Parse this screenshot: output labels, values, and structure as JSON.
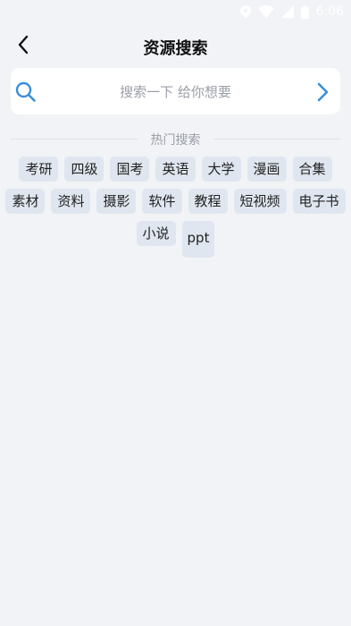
{
  "status_bar": {
    "time": "6:06"
  },
  "header": {
    "title": "资源搜索"
  },
  "search": {
    "placeholder": "搜索一下 给你想要",
    "value": ""
  },
  "hot": {
    "title": "热门搜索",
    "tags": [
      "考研",
      "四级",
      "国考",
      "英语",
      "大学",
      "漫画",
      "合集",
      "素材",
      "资料",
      "摄影",
      "软件",
      "教程",
      "短视频",
      "电子书",
      "小说",
      "ppt"
    ]
  },
  "colors": {
    "accent": "#3a8fd8",
    "tag_bg": "#dfe6ef",
    "page_bg": "#f1f3f6"
  }
}
